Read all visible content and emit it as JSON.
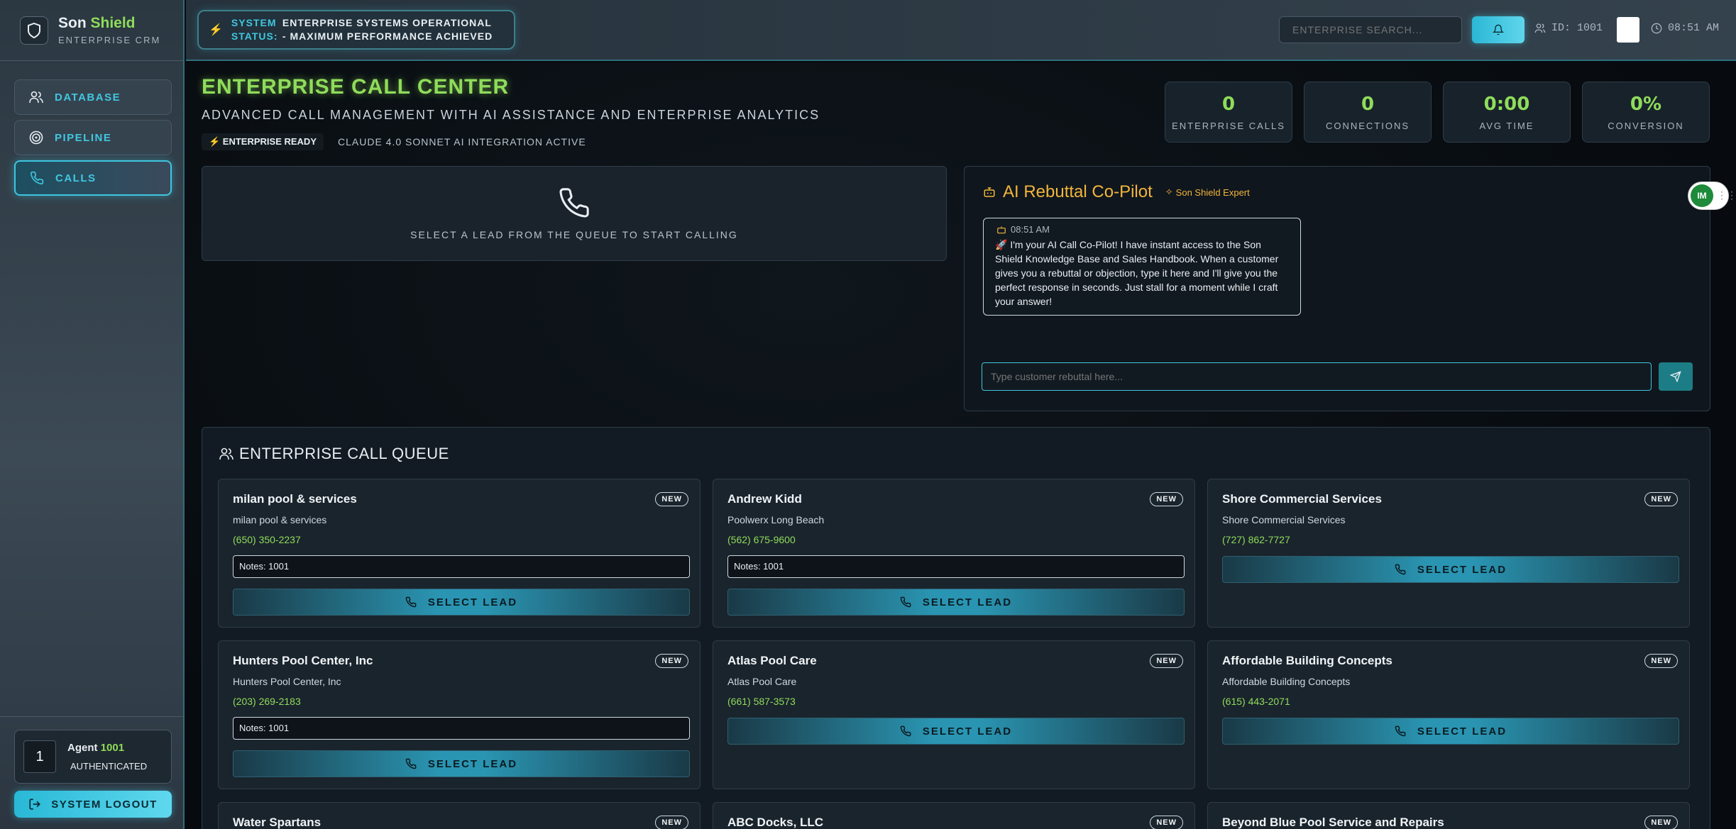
{
  "sidebar": {
    "brand_main": "Son ",
    "brand_accent": "Shield",
    "brand_sub": "ENTERPRISE CRM",
    "nav": [
      {
        "label": "DATABASE"
      },
      {
        "label": "PIPELINE"
      },
      {
        "label": "CALLS"
      }
    ],
    "agent": {
      "number": "1",
      "prefix": "Agent ",
      "id": "1001",
      "status": "AUTHENTICATED"
    },
    "logout_label": "SYSTEM LOGOUT"
  },
  "topbar": {
    "status_label": "SYSTEM STATUS:",
    "status_text": "ENTERPRISE SYSTEMS OPERATIONAL - MAXIMUM PERFORMANCE ACHIEVED",
    "search_placeholder": "ENTERPRISE SEARCH...",
    "agent_id": "ID: 1001",
    "time": "08:51 AM"
  },
  "header": {
    "title": "ENTERPRISE CALL CENTER",
    "subtitle": "ADVANCED CALL MANAGEMENT WITH AI ASSISTANCE AND ENTERPRISE ANALYTICS",
    "badge_ready": "⚡ ENTERPRISE READY",
    "badge_ai": "CLAUDE 4.0 SONNET AI INTEGRATION ACTIVE"
  },
  "stats": [
    {
      "value": "0",
      "label": "ENTERPRISE CALLS"
    },
    {
      "value": "0",
      "label": "CONNECTIONS"
    },
    {
      "value": "0:00",
      "label": "AVG TIME"
    },
    {
      "value": "0%",
      "label": "CONVERSION"
    }
  ],
  "call_panel": {
    "text": "SELECT A LEAD FROM THE QUEUE TO START CALLING"
  },
  "ai": {
    "title": "AI Rebuttal Co-Pilot",
    "chip": "Son Shield Expert",
    "msg_time": "08:51 AM",
    "msg_text": "🚀 I'm your AI Call Co-Pilot! I have instant access to the Son Shield Knowledge Base and Sales Handbook. When a customer gives you a rebuttal or objection, type it here and I'll give you the perfect response in seconds. Just stall for a moment while I craft your answer!",
    "input_placeholder": "Type customer rebuttal here..."
  },
  "toggle_label": "IM",
  "queue": {
    "title": "ENTERPRISE CALL QUEUE",
    "select_label": "SELECT LEAD",
    "leads": [
      {
        "name": "milan pool & services",
        "badge": "NEW",
        "company": "milan pool & services",
        "phone": "(650) 350-2237",
        "notes": "Notes: 1001"
      },
      {
        "name": "Andrew Kidd",
        "badge": "NEW",
        "company": "Poolwerx Long Beach",
        "phone": "(562) 675-9600",
        "notes": "Notes: 1001"
      },
      {
        "name": "Shore Commercial Services",
        "badge": "NEW",
        "company": "Shore Commercial Services",
        "phone": "(727) 862-7727",
        "notes": ""
      },
      {
        "name": "Hunters Pool Center, Inc",
        "badge": "NEW",
        "company": "Hunters Pool Center, Inc",
        "phone": "(203) 269-2183",
        "notes": "Notes: 1001"
      },
      {
        "name": "Atlas Pool Care",
        "badge": "NEW",
        "company": "Atlas Pool Care",
        "phone": "(661) 587-3573",
        "notes": ""
      },
      {
        "name": "Affordable Building Concepts",
        "badge": "NEW",
        "company": "Affordable Building Concepts",
        "phone": "(615) 443-2071",
        "notes": ""
      },
      {
        "name": "Water Spartans",
        "badge": "NEW",
        "company": "",
        "phone": "",
        "notes": ""
      },
      {
        "name": "ABC Docks, LLC",
        "badge": "NEW",
        "company": "",
        "phone": "",
        "notes": ""
      },
      {
        "name": "Beyond Blue Pool Service and Repairs",
        "badge": "NEW",
        "company": "",
        "phone": "",
        "notes": ""
      }
    ]
  }
}
